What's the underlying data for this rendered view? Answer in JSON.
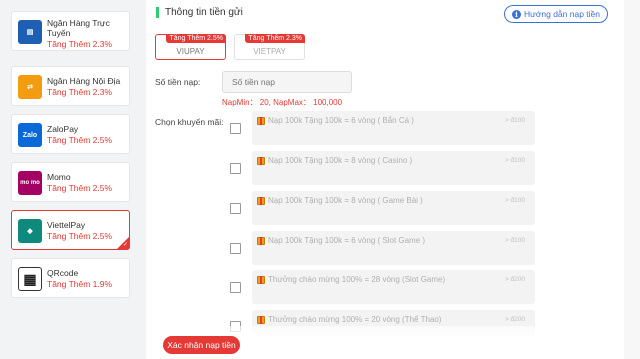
{
  "sidebar": {
    "items": [
      {
        "name_line1": "Ngân Hàng Trực",
        "name_line2": "Tuyến",
        "bonus": "Tăng Thêm 2.3%",
        "logo_text": "▤",
        "logo_color": "#1e5fb4",
        "icon": "online-bank-icon"
      },
      {
        "name_line1": "Ngân Hàng Nội Địa",
        "bonus": "Tăng Thêm 2.3%",
        "logo_text": "⇄",
        "logo_color": "#f39c12",
        "icon": "domestic-bank-icon"
      },
      {
        "name_line1": "ZaloPay",
        "bonus": "Tăng Thêm 2.5%",
        "logo_text": "Zalo",
        "logo_color": "#0a68d8",
        "icon": "zalopay-icon"
      },
      {
        "name_line1": "Momo",
        "bonus": "Tăng Thêm 2.5%",
        "logo_text": "mo mo",
        "logo_color": "#a50064",
        "icon": "momo-icon"
      },
      {
        "name_line1": "ViettelPay",
        "bonus": "Tăng Thêm 2.5%",
        "logo_text": "◆",
        "logo_color": "#0e8a7d",
        "icon": "viettelpay-icon",
        "active": true
      },
      {
        "name_line1": "QRcode",
        "bonus": "Tăng Thêm 1.9%",
        "logo_text": "▦",
        "logo_color": "#222222",
        "icon": "qrcode-icon"
      }
    ]
  },
  "main": {
    "title": "Thông tin tiền gửi",
    "guide_button": "Hướng dẫn nạp tiền",
    "channels": [
      {
        "label": "VIUPAY",
        "tag": "Tăng Thêm 2.5%",
        "selected": true
      },
      {
        "label": "VIETPAY",
        "tag": "Tăng Thêm 2.3%",
        "selected": false
      }
    ],
    "amount_label": "Số tiền nạp:",
    "amount_placeholder": "Số tiền nạp",
    "limits": "NapMin： 20,  NạpMax： 100,000",
    "promo_label": "Chọn khuyến mãi:",
    "promotions": [
      {
        "text": "Nạp 100k Tặng 100k = 6 vòng ( Bắn Cá )",
        "min": "> đ100"
      },
      {
        "text": "Nạp 100k Tặng 100k = 8 vòng ( Casino )",
        "min": "> đ100"
      },
      {
        "text": "Nạp 100k Tặng 100k = 8 vòng ( Game Bài )",
        "min": "> đ100"
      },
      {
        "text": "Nạp 100k Tặng 100k = 6 vòng ( Slot Game )",
        "min": "> đ100"
      },
      {
        "text": "Thưởng chào mừng 100% = 28 vòng (Slot Game)",
        "min": "> đ200"
      },
      {
        "text": "Thưởng chào mừng 100% = 20 vòng (Thể Thao)",
        "min": "> đ200"
      }
    ],
    "confirm_button": "Xác nhận nạp tiền"
  },
  "colors": {
    "accent_red": "#e53935",
    "accent_blue": "#3b6fd8",
    "section_green": "#2ecc71"
  }
}
